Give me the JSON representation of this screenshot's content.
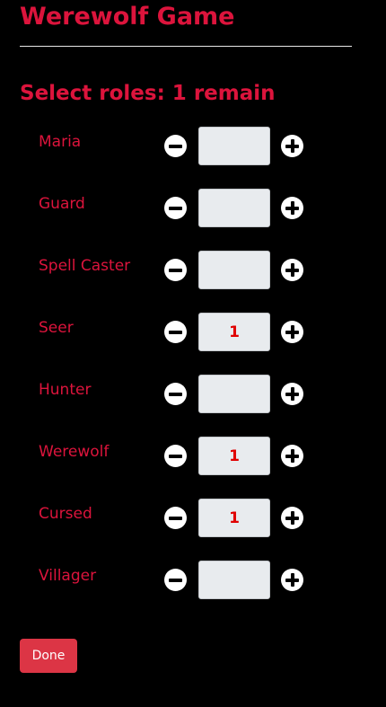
{
  "header": {
    "title": "Werewolf Game"
  },
  "selection": {
    "prompt": "Select roles: 1 remain"
  },
  "roles": [
    {
      "name": "Maria",
      "count": ""
    },
    {
      "name": "Guard",
      "count": ""
    },
    {
      "name": "Spell Caster",
      "count": ""
    },
    {
      "name": "Seer",
      "count": "1"
    },
    {
      "name": "Hunter",
      "count": ""
    },
    {
      "name": "Werewolf",
      "count": "1"
    },
    {
      "name": "Cursed",
      "count": "1"
    },
    {
      "name": "Villager",
      "count": ""
    }
  ],
  "icons": {
    "decrement": "minus-circle-icon",
    "increment": "plus-circle-icon"
  },
  "actions": {
    "done_label": "Done"
  },
  "colors": {
    "accent": "#dc143c",
    "button": "#dc3545",
    "count_text": "#e00000",
    "background": "#000000"
  }
}
